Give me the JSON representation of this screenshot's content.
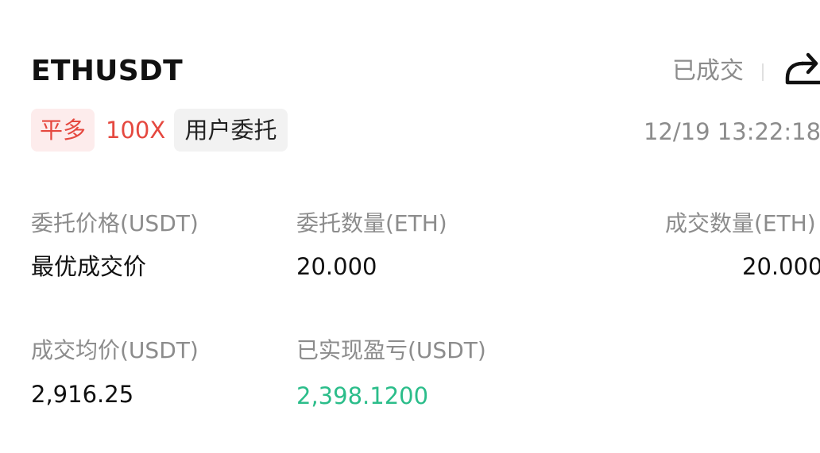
{
  "header": {
    "symbol": "ETHUSDT",
    "status": "已成交",
    "share_icon": "share-icon"
  },
  "tags": {
    "side": "平多",
    "leverage": "100X",
    "order_type": "用户委托"
  },
  "timestamp": "12/19 13:22:18",
  "fields": {
    "order_price": {
      "label": "委托价格(USDT)",
      "value": "最优成交价"
    },
    "order_qty": {
      "label": "委托数量(ETH)",
      "value": "20.000"
    },
    "filled_qty": {
      "label": "成交数量(ETH)",
      "value": "20.000"
    },
    "avg_price": {
      "label": "成交均价(USDT)",
      "value": "2,916.25"
    },
    "realized_pnl": {
      "label": "已实现盈亏(USDT)",
      "value": "2,398.1200"
    }
  },
  "colors": {
    "sell": "#e5483f",
    "profit": "#2bbd8a",
    "muted": "#8c8c8c",
    "text": "#111111"
  }
}
